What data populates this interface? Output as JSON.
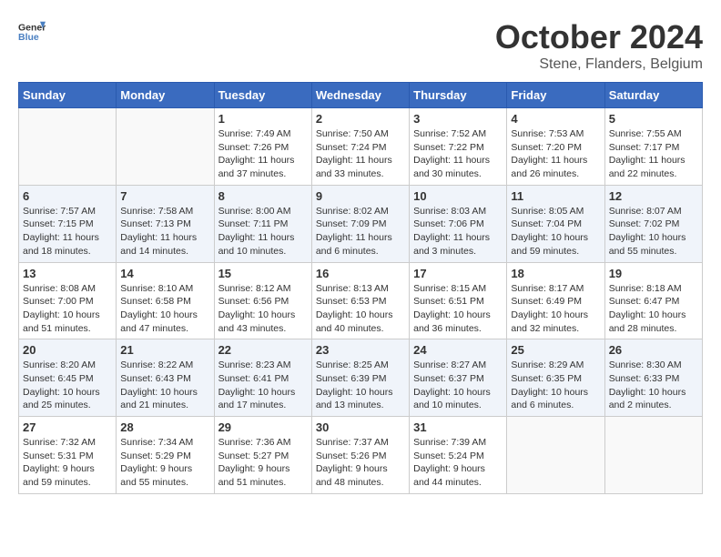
{
  "header": {
    "logo_line1": "General",
    "logo_line2": "Blue",
    "month": "October 2024",
    "location": "Stene, Flanders, Belgium"
  },
  "days_of_week": [
    "Sunday",
    "Monday",
    "Tuesday",
    "Wednesday",
    "Thursday",
    "Friday",
    "Saturday"
  ],
  "weeks": [
    [
      {
        "day": "",
        "sunrise": "",
        "sunset": "",
        "daylight": ""
      },
      {
        "day": "",
        "sunrise": "",
        "sunset": "",
        "daylight": ""
      },
      {
        "day": "1",
        "sunrise": "Sunrise: 7:49 AM",
        "sunset": "Sunset: 7:26 PM",
        "daylight": "Daylight: 11 hours and 37 minutes."
      },
      {
        "day": "2",
        "sunrise": "Sunrise: 7:50 AM",
        "sunset": "Sunset: 7:24 PM",
        "daylight": "Daylight: 11 hours and 33 minutes."
      },
      {
        "day": "3",
        "sunrise": "Sunrise: 7:52 AM",
        "sunset": "Sunset: 7:22 PM",
        "daylight": "Daylight: 11 hours and 30 minutes."
      },
      {
        "day": "4",
        "sunrise": "Sunrise: 7:53 AM",
        "sunset": "Sunset: 7:20 PM",
        "daylight": "Daylight: 11 hours and 26 minutes."
      },
      {
        "day": "5",
        "sunrise": "Sunrise: 7:55 AM",
        "sunset": "Sunset: 7:17 PM",
        "daylight": "Daylight: 11 hours and 22 minutes."
      }
    ],
    [
      {
        "day": "6",
        "sunrise": "Sunrise: 7:57 AM",
        "sunset": "Sunset: 7:15 PM",
        "daylight": "Daylight: 11 hours and 18 minutes."
      },
      {
        "day": "7",
        "sunrise": "Sunrise: 7:58 AM",
        "sunset": "Sunset: 7:13 PM",
        "daylight": "Daylight: 11 hours and 14 minutes."
      },
      {
        "day": "8",
        "sunrise": "Sunrise: 8:00 AM",
        "sunset": "Sunset: 7:11 PM",
        "daylight": "Daylight: 11 hours and 10 minutes."
      },
      {
        "day": "9",
        "sunrise": "Sunrise: 8:02 AM",
        "sunset": "Sunset: 7:09 PM",
        "daylight": "Daylight: 11 hours and 6 minutes."
      },
      {
        "day": "10",
        "sunrise": "Sunrise: 8:03 AM",
        "sunset": "Sunset: 7:06 PM",
        "daylight": "Daylight: 11 hours and 3 minutes."
      },
      {
        "day": "11",
        "sunrise": "Sunrise: 8:05 AM",
        "sunset": "Sunset: 7:04 PM",
        "daylight": "Daylight: 10 hours and 59 minutes."
      },
      {
        "day": "12",
        "sunrise": "Sunrise: 8:07 AM",
        "sunset": "Sunset: 7:02 PM",
        "daylight": "Daylight: 10 hours and 55 minutes."
      }
    ],
    [
      {
        "day": "13",
        "sunrise": "Sunrise: 8:08 AM",
        "sunset": "Sunset: 7:00 PM",
        "daylight": "Daylight: 10 hours and 51 minutes."
      },
      {
        "day": "14",
        "sunrise": "Sunrise: 8:10 AM",
        "sunset": "Sunset: 6:58 PM",
        "daylight": "Daylight: 10 hours and 47 minutes."
      },
      {
        "day": "15",
        "sunrise": "Sunrise: 8:12 AM",
        "sunset": "Sunset: 6:56 PM",
        "daylight": "Daylight: 10 hours and 43 minutes."
      },
      {
        "day": "16",
        "sunrise": "Sunrise: 8:13 AM",
        "sunset": "Sunset: 6:53 PM",
        "daylight": "Daylight: 10 hours and 40 minutes."
      },
      {
        "day": "17",
        "sunrise": "Sunrise: 8:15 AM",
        "sunset": "Sunset: 6:51 PM",
        "daylight": "Daylight: 10 hours and 36 minutes."
      },
      {
        "day": "18",
        "sunrise": "Sunrise: 8:17 AM",
        "sunset": "Sunset: 6:49 PM",
        "daylight": "Daylight: 10 hours and 32 minutes."
      },
      {
        "day": "19",
        "sunrise": "Sunrise: 8:18 AM",
        "sunset": "Sunset: 6:47 PM",
        "daylight": "Daylight: 10 hours and 28 minutes."
      }
    ],
    [
      {
        "day": "20",
        "sunrise": "Sunrise: 8:20 AM",
        "sunset": "Sunset: 6:45 PM",
        "daylight": "Daylight: 10 hours and 25 minutes."
      },
      {
        "day": "21",
        "sunrise": "Sunrise: 8:22 AM",
        "sunset": "Sunset: 6:43 PM",
        "daylight": "Daylight: 10 hours and 21 minutes."
      },
      {
        "day": "22",
        "sunrise": "Sunrise: 8:23 AM",
        "sunset": "Sunset: 6:41 PM",
        "daylight": "Daylight: 10 hours and 17 minutes."
      },
      {
        "day": "23",
        "sunrise": "Sunrise: 8:25 AM",
        "sunset": "Sunset: 6:39 PM",
        "daylight": "Daylight: 10 hours and 13 minutes."
      },
      {
        "day": "24",
        "sunrise": "Sunrise: 8:27 AM",
        "sunset": "Sunset: 6:37 PM",
        "daylight": "Daylight: 10 hours and 10 minutes."
      },
      {
        "day": "25",
        "sunrise": "Sunrise: 8:29 AM",
        "sunset": "Sunset: 6:35 PM",
        "daylight": "Daylight: 10 hours and 6 minutes."
      },
      {
        "day": "26",
        "sunrise": "Sunrise: 8:30 AM",
        "sunset": "Sunset: 6:33 PM",
        "daylight": "Daylight: 10 hours and 2 minutes."
      }
    ],
    [
      {
        "day": "27",
        "sunrise": "Sunrise: 7:32 AM",
        "sunset": "Sunset: 5:31 PM",
        "daylight": "Daylight: 9 hours and 59 minutes."
      },
      {
        "day": "28",
        "sunrise": "Sunrise: 7:34 AM",
        "sunset": "Sunset: 5:29 PM",
        "daylight": "Daylight: 9 hours and 55 minutes."
      },
      {
        "day": "29",
        "sunrise": "Sunrise: 7:36 AM",
        "sunset": "Sunset: 5:27 PM",
        "daylight": "Daylight: 9 hours and 51 minutes."
      },
      {
        "day": "30",
        "sunrise": "Sunrise: 7:37 AM",
        "sunset": "Sunset: 5:26 PM",
        "daylight": "Daylight: 9 hours and 48 minutes."
      },
      {
        "day": "31",
        "sunrise": "Sunrise: 7:39 AM",
        "sunset": "Sunset: 5:24 PM",
        "daylight": "Daylight: 9 hours and 44 minutes."
      },
      {
        "day": "",
        "sunrise": "",
        "sunset": "",
        "daylight": ""
      },
      {
        "day": "",
        "sunrise": "",
        "sunset": "",
        "daylight": ""
      }
    ]
  ]
}
